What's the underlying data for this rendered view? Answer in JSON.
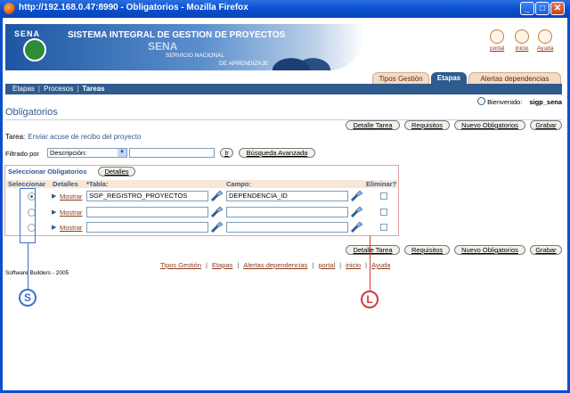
{
  "window": {
    "title": "http://192.168.0.47:8990 - Obligatorios - Mozilla Firefox"
  },
  "banner": {
    "logo_text": "SENA",
    "system_title": "SISTEMA INTEGRAL DE GESTION DE PROYECTOS",
    "org_short": "SENA",
    "org_line1": "SERVICIO NACIONAL",
    "org_line2": "DE APRENDIZAJE"
  },
  "top_links": [
    {
      "label": "portal",
      "icon": "portal-icon"
    },
    {
      "label": "inicio",
      "icon": "home-icon"
    },
    {
      "label": "Ayuda",
      "icon": "help-icon"
    }
  ],
  "tabs": [
    {
      "label": "Tipos Gestión",
      "active": false
    },
    {
      "label": "Etapas",
      "active": true
    },
    {
      "label": "Alertas dependencias",
      "active": false
    }
  ],
  "breadcrumb": {
    "items": [
      "Etapas",
      "Procesos",
      "Tareas"
    ],
    "current": "Tareas"
  },
  "welcome": {
    "label": "Bienvenido:",
    "user": "sigp_sena"
  },
  "page_title": "Obligatorios",
  "toolbar": {
    "detalle_tarea": "Detalle Tarea",
    "requisitos": "Requisitos",
    "nuevo_obligatorios": "Nuevo Obligatorios",
    "grabar": "Grabar"
  },
  "task": {
    "label": "Tarea:",
    "value": "Enviar acuse de recibo del proyecto"
  },
  "filter": {
    "label": "Filtrado por",
    "selected": "Descripción:",
    "text_value": "",
    "go_button": "Ir",
    "advanced_button": "Búsqueda Avanzada"
  },
  "grid": {
    "title": "Seleccionar Obligatorios",
    "details_button": "Detalles",
    "headers": {
      "select": "Seleccionar",
      "details": "Detalles",
      "table": "*Tabla:",
      "field": "Campo:",
      "delete": "Eliminar?"
    },
    "rows": [
      {
        "selected": true,
        "link": "Mostrar",
        "table": "SGP_REGISTRO_PROYECTOS",
        "field": "DEPENDENCIA_ID",
        "delete": false
      },
      {
        "selected": false,
        "link": "Mostrar",
        "table": "",
        "field": "",
        "delete": false
      },
      {
        "selected": false,
        "link": "Mostrar",
        "table": "",
        "field": "",
        "delete": false
      }
    ]
  },
  "footer": {
    "links": [
      "Tipos Gestión",
      "Etapas",
      "Alertas dependencias",
      "portal",
      "inicio",
      "Ayuda"
    ],
    "credit": "Software Builders - 2005"
  },
  "annotations": {
    "s_label": "S",
    "l_label": "L",
    "s_color": "#3d6fd0",
    "l_color": "#d43a3a"
  },
  "colors": {
    "accent": "#2f5b8e",
    "link": "#8b3a1a",
    "tab_inactive": "#f3dcc6"
  }
}
